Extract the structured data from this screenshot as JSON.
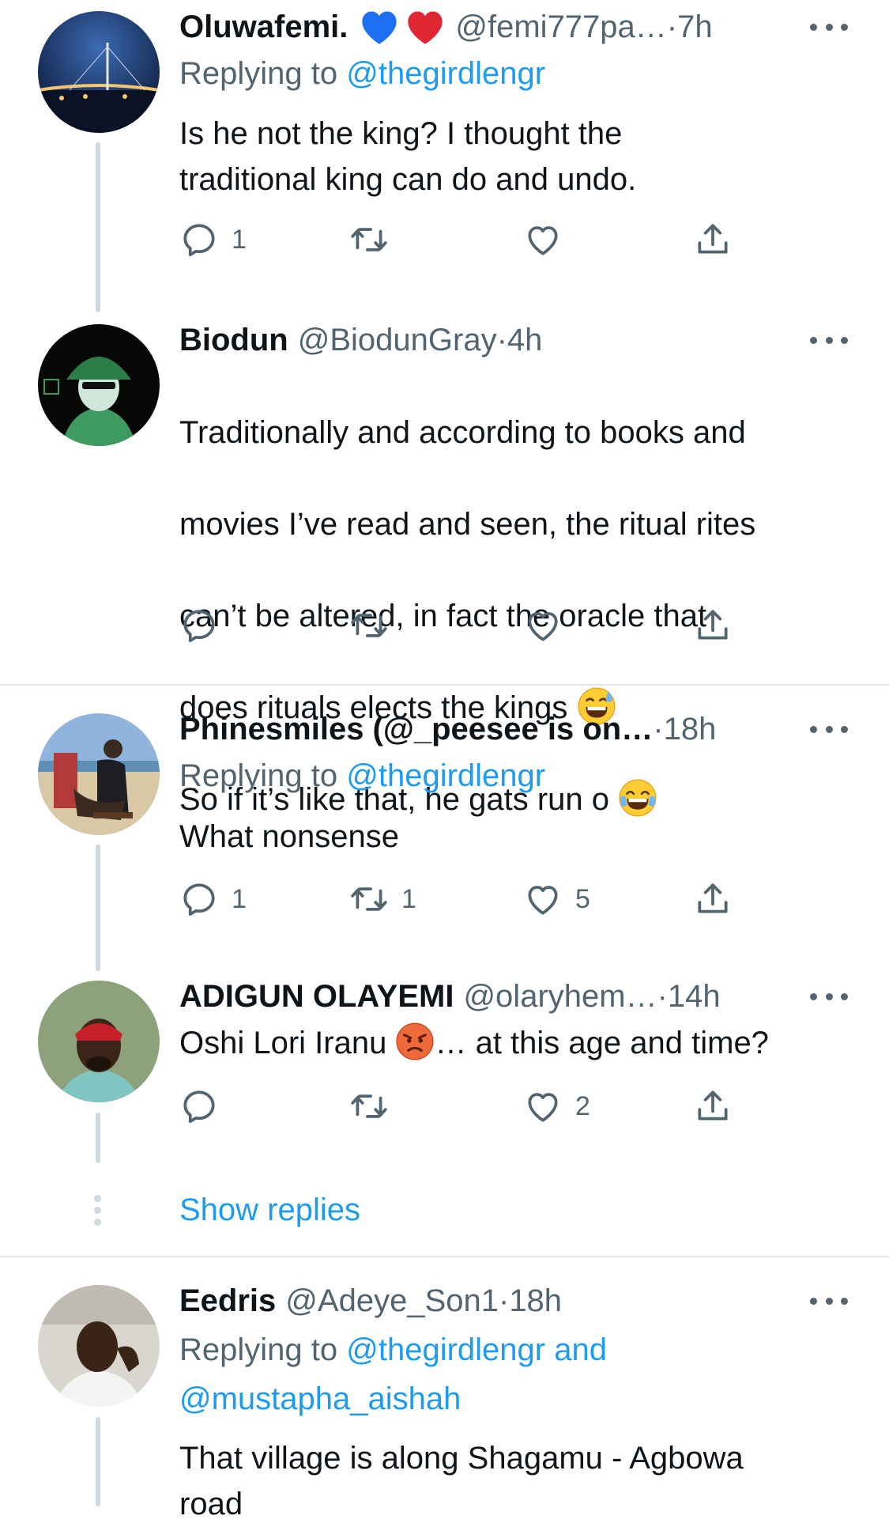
{
  "tweets": [
    {
      "name": "Oluwafemi.",
      "handle": "@femi777pa…",
      "time": "7h",
      "replying_label": "Replying to ",
      "replying_to": "@thegirdlengr",
      "text": "Is he not the king? I thought the\ntraditional king can do and undo.",
      "counts": {
        "reply": "1",
        "retweet": "",
        "like": ""
      }
    },
    {
      "name": "Biodun",
      "handle": "@BiodunGray",
      "time": "4h",
      "text_lines": [
        "Traditionally and according to books and",
        "movies I’ve read and seen, the ritual rites",
        "can’t be altered, in fact the oracle that",
        "does rituals elects the kings",
        "So if it’s like that, he gats run o"
      ],
      "counts": {
        "reply": "",
        "retweet": "",
        "like": ""
      }
    },
    {
      "name": "Phinesmiles (@_peesee is on…",
      "handle": "",
      "time": "18h",
      "replying_label": "Replying to ",
      "replying_to": "@thegirdlengr",
      "text": "What nonsense",
      "counts": {
        "reply": "1",
        "retweet": "1",
        "like": "5"
      }
    },
    {
      "name": "ADIGUN OLAYEMI",
      "handle": "@olaryhem…",
      "time": "14h",
      "text_before": "Oshi Lori Iranu ",
      "text_after": "… at this age and time?",
      "counts": {
        "reply": "",
        "retweet": "",
        "like": "2"
      },
      "show_replies": "Show replies"
    },
    {
      "name": "Eedris",
      "handle": "@Adeye_Son1",
      "time": "18h",
      "replying_label": "Replying to ",
      "replying_to": "@thegirdlengr and\n@mustapha_aishah",
      "text": "That village is along Shagamu - Agbowa\nroad"
    }
  ],
  "separator": " · ",
  "colors": {
    "link": "#1d9bf0",
    "muted": "#536471",
    "heart_blue": "#1d6ff2",
    "heart_red": "#e0245e"
  },
  "icons": [
    "reply-icon",
    "retweet-icon",
    "like-icon",
    "share-icon",
    "more-icon",
    "blue-heart-emoji",
    "red-heart-emoji",
    "sweat-smile-emoji",
    "tears-of-joy-emoji",
    "angry-face-emoji"
  ]
}
